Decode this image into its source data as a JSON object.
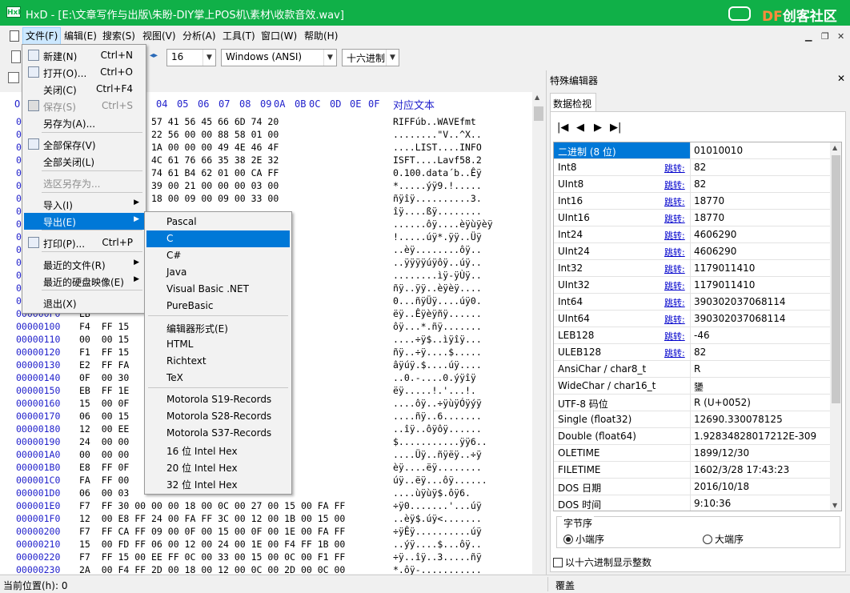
{
  "window": {
    "app_icon": "HxD",
    "title": "HxD - [E:\\文章写作与出版\\朱盼-DIY掌上POS机\\素材\\收款音效.wav]",
    "watermark_df": "DF",
    "watermark_rest": "创客社区"
  },
  "menubar": {
    "items": [
      "文件(F)",
      "编辑(E)",
      "搜索(S)",
      "视图(V)",
      "分析(A)",
      "工具(T)",
      "窗口(W)",
      "帮助(H)"
    ],
    "active": "文件(F)"
  },
  "toolbar": {
    "bytes_per_row": "16",
    "charset": "Windows (ANSI)",
    "offset_base": "十六进制"
  },
  "hex": {
    "offset_label": "O",
    "columns": [
      "04",
      "05",
      "06",
      "07",
      "08",
      "09",
      "0A",
      "0B",
      "0C",
      "0D",
      "0E",
      "0F"
    ],
    "text_header": "对应文本",
    "rows": [
      {
        "off": "00000000",
        "bytes": "FA  62 01 00 57 41 56 45 66 6D 74 20",
        "text": "RIFFúb..WAVEfmt "
      },
      {
        "off": "00000010",
        "bytes": "01  00 02 00 22 56 00 00 88 58 01 00",
        "text": "........\"V..^X.."
      },
      {
        "off": "00000020",
        "bytes": "4C  49 53 54 1A 00 00 00 49 4E 46 4F",
        "text": "....LIST....INFO"
      },
      {
        "off": "00000030",
        "bytes": "0E  00 00 00 4C 61 76 66 35 38 2E 32",
        "text": "ISFT....Lavf58.2"
      },
      {
        "off": "00000040",
        "bytes": "30  00 64 61 74 61 B4 62 01 00 CA FF",
        "text": "0.100.data´b..Êÿ"
      },
      {
        "off": "00000050",
        "bytes": "06  00 FD FF 39 00 21 00 00 00 03 00",
        "text": "*.....ýÿ9.!....."
      },
      {
        "off": "00000060",
        "bytes": "0C  00 03 00 18 00 09 00 09 00 33 00",
        "text": "ñÿîÿ..........3."
      },
      {
        "off": "00000070",
        "bytes": "",
        "text": "îÿ....ßÿ........"
      },
      {
        "off": "00000080",
        "bytes": "",
        "text": "......ôÿ....èÿùÿèÿ"
      },
      {
        "off": "00000090",
        "bytes": "",
        "text": "!.....úÿ*.ÿÿ..Üÿ"
      },
      {
        "off": "000000A0",
        "bytes": "",
        "text": "..èÿ........ôÿ.."
      },
      {
        "off": "000000B0",
        "bytes": "",
        "text": "..ÿÿÿÿúÿôÿ..úÿ.."
      },
      {
        "off": "000000C0",
        "bytes": "",
        "text": "........ìÿ-ÿÙÿ.."
      },
      {
        "off": "000000D0",
        "bytes": "",
        "text": "ñÿ..ÿÿ..èÿèÿ...."
      },
      {
        "off": "000000E0",
        "bytes": "",
        "text": "0...ñÿÜÿ....úÿ0."
      },
      {
        "off": "000000F0",
        "bytes": "EB",
        "text": "ëÿ..Êÿèÿñÿ......"
      },
      {
        "off": "00000100",
        "bytes": "F4  FF 15",
        "text": "ôÿ...*.ñÿ......."
      },
      {
        "off": "00000110",
        "bytes": "00  00 15",
        "text": "....÷ÿ$..ìÿîÿ..."
      },
      {
        "off": "00000120",
        "bytes": "F1  FF 15",
        "text": "ñÿ..÷ÿ....$....."
      },
      {
        "off": "00000130",
        "bytes": "E2  FF FA",
        "text": "âÿúÿ.$....úÿ...."
      },
      {
        "off": "00000140",
        "bytes": "0F  00 30",
        "text": "..0.-....0.ýÿîÿ"
      },
      {
        "off": "00000150",
        "bytes": "EB  FF 1E",
        "text": "ëÿ.....!.'...!."
      },
      {
        "off": "00000160",
        "bytes": "15  00 0F",
        "text": "....ôÿ..÷ÿùÿÓÿýÿ"
      },
      {
        "off": "00000170",
        "bytes": "06  00 15",
        "text": "....ñÿ..6......."
      },
      {
        "off": "00000180",
        "bytes": "12  00 EE",
        "text": "..îÿ..ôÿôÿ......"
      },
      {
        "off": "00000190",
        "bytes": "24  00 00",
        "text": "$...........ÿÿ6.."
      },
      {
        "off": "000001A0",
        "bytes": "00  00 00",
        "text": "....Üÿ..ñÿëÿ..÷ÿ"
      },
      {
        "off": "000001B0",
        "bytes": "E8  FF 0F",
        "text": "èÿ....ëÿ........"
      },
      {
        "off": "000001C0",
        "bytes": "FA  FF 00",
        "text": "úÿ..ëÿ...ôÿ......"
      },
      {
        "off": "000001D0",
        "bytes": "06  00 03",
        "text": "....ùÿùÿ$.ôÿ6."
      },
      {
        "off": "000001E0",
        "bytes": "F7  FF 30 00 00 00 18 00 0C 00 27 00 15 00 FA FF",
        "text": "÷ÿ0.......'...úÿ"
      },
      {
        "off": "000001F0",
        "bytes": "12  00 E8 FF 24 00 FA FF 3C 00 12 00 1B 00 15 00",
        "text": "..èÿ$.úÿ<......."
      },
      {
        "off": "00000200",
        "bytes": "F7  FF CA FF 09 00 0F 00 15 00 0F 00 1E 00 FA FF",
        "text": "÷ÿÊÿ..........úÿ"
      },
      {
        "off": "00000210",
        "bytes": "15  00 FD FF 06 00 12 00 24 00 1E 00 F4 FF 1B 00",
        "text": "..ýÿ....$...ôÿ.."
      },
      {
        "off": "00000220",
        "bytes": "F7  FF 15 00 EE FF 0C 00 33 00 15 00 0C 00 F1 FF",
        "text": "÷ÿ..îÿ..3.....ñÿ"
      },
      {
        "off": "00000230",
        "bytes": "2A  00 F4 FF 2D 00 18 00 12 00 0C 00 2D 00 0C 00",
        "text": "*.ôÿ-..........."
      }
    ]
  },
  "file_menu": [
    {
      "label": "新建(N)",
      "shortcut": "Ctrl+N",
      "icon": "new-file-icon"
    },
    {
      "label": "打开(O)...",
      "shortcut": "Ctrl+O",
      "icon": "open-folder-icon"
    },
    {
      "label": "关闭(C)",
      "shortcut": "Ctrl+F4"
    },
    {
      "label": "保存(S)",
      "shortcut": "Ctrl+S",
      "disabled": true,
      "icon": "save-icon"
    },
    {
      "label": "另存为(A)...",
      "shortcut": ""
    },
    {
      "label": "全部保存(V)",
      "shortcut": "",
      "icon": "save-all-icon"
    },
    {
      "label": "全部关闭(L)",
      "shortcut": ""
    },
    {
      "label": "选区另存为...",
      "shortcut": "",
      "disabled": true
    },
    {
      "label": "导入(I)",
      "submenu": true
    },
    {
      "label": "导出(E)",
      "submenu": true,
      "highlighted": true
    },
    {
      "label": "打印(P)...",
      "shortcut": "Ctrl+P",
      "icon": "print-icon"
    },
    {
      "label": "最近的文件(R)",
      "submenu": true
    },
    {
      "label": "最近的硬盘映像(E)",
      "submenu": true
    },
    {
      "label": "退出(X)",
      "shortcut": ""
    }
  ],
  "export_menu": [
    "Pascal",
    "C",
    "C#",
    "Java",
    "Visual Basic .NET",
    "PureBasic",
    "编辑器形式(E)",
    "HTML",
    "Richtext",
    "TeX",
    "Motorola S19-Records",
    "Motorola S28-Records",
    "Motorola S37-Records",
    "16 位 Intel Hex",
    "20 位 Intel Hex",
    "32 位 Intel Hex"
  ],
  "export_highlighted": "C",
  "special_editor": {
    "title": "特殊编辑器",
    "tab": "数据检视",
    "jump_label": "跳转:",
    "rows": [
      {
        "name": "二进制 (8 位)",
        "value": "01010010",
        "jump": false,
        "selected": true
      },
      {
        "name": "Int8",
        "value": "82",
        "jump": true
      },
      {
        "name": "UInt8",
        "value": "82",
        "jump": true
      },
      {
        "name": "Int16",
        "value": "18770",
        "jump": true
      },
      {
        "name": "UInt16",
        "value": "18770",
        "jump": true
      },
      {
        "name": "Int24",
        "value": "4606290",
        "jump": true
      },
      {
        "name": "UInt24",
        "value": "4606290",
        "jump": true
      },
      {
        "name": "Int32",
        "value": "1179011410",
        "jump": true
      },
      {
        "name": "UInt32",
        "value": "1179011410",
        "jump": true
      },
      {
        "name": "Int64",
        "value": "390302037068114",
        "jump": true
      },
      {
        "name": "UInt64",
        "value": "390302037068114",
        "jump": true
      },
      {
        "name": "LEB128",
        "value": "-46",
        "jump": true
      },
      {
        "name": "ULEB128",
        "value": "82",
        "jump": true
      },
      {
        "name": "AnsiChar / char8_t",
        "value": "R",
        "jump": false
      },
      {
        "name": "WideChar / char16_t",
        "value": "䥒",
        "jump": false
      },
      {
        "name": "UTF-8 码位",
        "value": "R (U+0052)",
        "jump": false
      },
      {
        "name": "Single (float32)",
        "value": "12690.330078125",
        "jump": false
      },
      {
        "name": "Double (float64)",
        "value": "1.92834828017212E-309",
        "jump": false
      },
      {
        "name": "OLETIME",
        "value": "1899/12/30",
        "jump": false
      },
      {
        "name": "FILETIME",
        "value": "1602/3/28 17:43:23",
        "jump": false
      },
      {
        "name": "DOS 日期",
        "value": "2016/10/18",
        "jump": false
      },
      {
        "name": "DOS 时间",
        "value": "9:10:36",
        "jump": false
      }
    ],
    "byte_order_label": "字节序",
    "little_endian": "小端序",
    "big_endian": "大端序",
    "hex_display_label": "以十六进制显示整数"
  },
  "status": {
    "position": "当前位置(h): 0",
    "mode": "覆盖"
  }
}
